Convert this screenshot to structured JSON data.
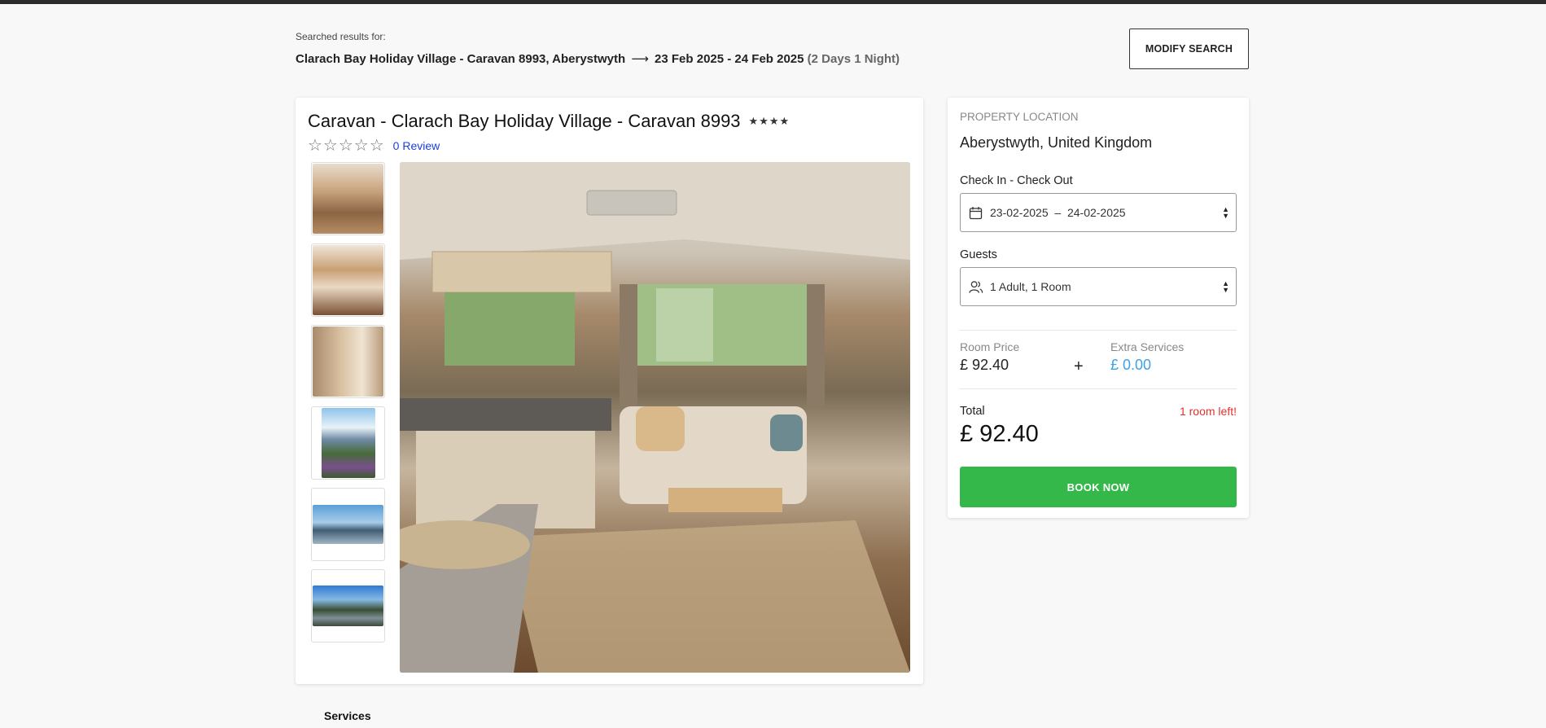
{
  "search": {
    "label": "Searched results for:",
    "location": "Clarach Bay Holiday Village - Caravan 8993, Aberystwyth",
    "arrow": "⟶",
    "dates": "23 Feb 2025 - 24 Feb 2025",
    "nights": "(2 Days 1 Night)",
    "modify_label": "MODIFY SEARCH"
  },
  "property": {
    "title": "Caravan  - Clarach Bay Holiday Village - Caravan 8993",
    "hotel_stars": "★★★★",
    "rating_stars": "☆☆☆☆☆",
    "review_link": "0 Review",
    "thumbnails": [
      "caravan-lounge-photo",
      "caravan-bedroom-photo",
      "caravan-bathroom-photo",
      "park-view-photo",
      "beach-view-photo",
      "coast-view-photo"
    ],
    "hero_image": "caravan-living-room-photo"
  },
  "booking": {
    "location_label": "PROPERTY LOCATION",
    "location": "Aberystwyth, United Kingdom",
    "dates_label": "Check In - Check Out",
    "dates_value": "23-02-2025  –  24-02-2025",
    "guests_label": "Guests",
    "guests_value": "1 Adult, 1 Room",
    "room_price_label": "Room Price",
    "room_price": "£ 92.40",
    "plus": "+",
    "extra_label": "Extra Services",
    "extra_price": "£ 0.00",
    "total_label": "Total",
    "rooms_left": "1 room left!",
    "total": "£ 92.40",
    "book_label": "BOOK NOW"
  },
  "sections": {
    "services_title": "Services"
  },
  "colors": {
    "book_button": "#35b84a",
    "extra_price": "#3ea0e8",
    "rooms_left": "#e0322e",
    "review_link": "#1a3fd9"
  }
}
